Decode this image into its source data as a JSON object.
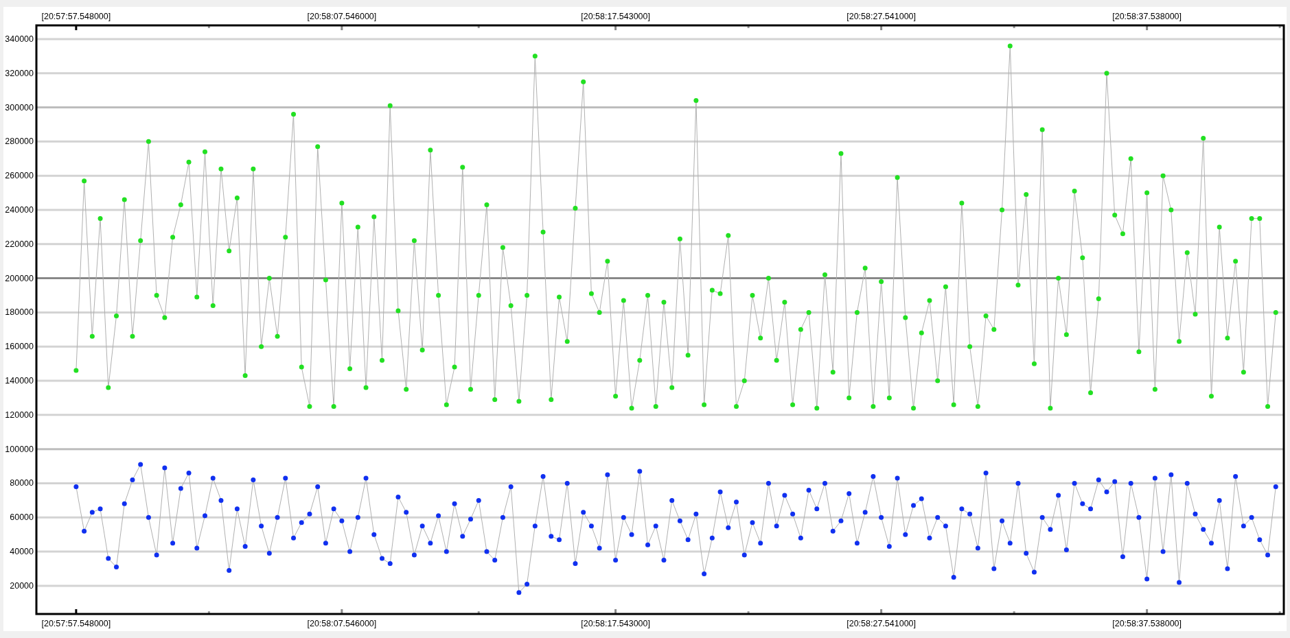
{
  "chart": {
    "chart_data": {
      "type": "line",
      "categories": [
        "[20:57:57.548000]",
        null,
        null,
        null,
        null,
        null,
        null,
        null,
        null,
        null,
        null,
        null,
        null,
        null,
        null,
        null,
        null,
        null,
        null,
        null,
        null,
        null,
        null,
        null,
        null,
        null,
        null,
        null,
        null,
        null,
        null,
        null,
        null,
        "[20:58:07.546000]",
        null,
        null,
        null,
        null,
        null,
        null,
        null,
        null,
        null,
        null,
        null,
        null,
        null,
        null,
        null,
        null,
        null,
        null,
        null,
        null,
        null,
        null,
        null,
        null,
        null,
        null,
        null,
        null,
        null,
        null,
        null,
        null,
        null,
        "[20:58:17.543000]",
        null,
        null,
        null,
        null,
        null,
        null,
        null,
        null,
        null,
        null,
        null,
        null,
        null,
        null,
        null,
        null,
        null,
        null,
        null,
        null,
        null,
        null,
        null,
        null,
        null,
        null,
        null,
        null,
        null,
        null,
        null,
        null,
        "[20:58:27.541000]",
        null,
        null,
        null,
        null,
        null,
        null,
        null,
        null,
        null,
        null,
        null,
        null,
        null,
        null,
        null,
        null,
        null,
        null,
        null,
        null,
        null,
        null,
        null,
        null,
        null,
        null,
        null,
        null,
        null,
        null,
        null,
        null,
        "[20:58:37.538000]",
        null,
        null,
        null,
        null,
        null,
        null,
        null,
        null,
        null,
        null,
        null,
        null,
        null,
        null,
        null,
        null
      ],
      "series": [
        {
          "color": "#22e022",
          "marker": "circle",
          "values": [
            146000,
            257000,
            166000,
            235000,
            136000,
            178000,
            246000,
            166000,
            222000,
            280000,
            190000,
            177000,
            224000,
            243000,
            268000,
            189000,
            274000,
            184000,
            264000,
            216000,
            247000,
            143000,
            264000,
            160000,
            200000,
            166000,
            224000,
            296000,
            148000,
            125000,
            277000,
            199000,
            125000,
            244000,
            147000,
            230000,
            136000,
            236000,
            152000,
            301000,
            181000,
            135000,
            222000,
            158000,
            275000,
            190000,
            126000,
            148000,
            265000,
            135000,
            190000,
            243000,
            129000,
            218000,
            184000,
            128000,
            190000,
            330000,
            227000,
            129000,
            189000,
            163000,
            241000,
            315000,
            191000,
            180000,
            210000,
            131000,
            187000,
            124000,
            152000,
            190000,
            125000,
            186000,
            136000,
            223000,
            155000,
            304000,
            126000,
            193000,
            191000,
            225000,
            125000,
            140000,
            190000,
            165000,
            200000,
            152000,
            186000,
            126000,
            170000,
            180000,
            124000,
            202000,
            145000,
            273000,
            130000,
            180000,
            206000,
            125000,
            198000,
            130000,
            259000,
            177000,
            124000,
            168000,
            187000,
            140000,
            195000,
            126000,
            244000,
            160000,
            125000,
            178000,
            170000,
            240000,
            336000,
            196000,
            249000,
            150000,
            287000,
            124000,
            200000,
            167000,
            251000,
            212000,
            133000,
            188000,
            320000,
            237000,
            226000,
            270000,
            157000,
            250000,
            135000,
            260000,
            240000,
            163000,
            215000,
            179000,
            282000,
            131000,
            230000,
            165000,
            210000,
            145000,
            235000,
            235000,
            125000,
            180000
          ]
        },
        {
          "color": "#1030f0",
          "marker": "circle",
          "values": [
            78000,
            52000,
            63000,
            65000,
            36000,
            31000,
            68000,
            82000,
            91000,
            60000,
            38000,
            89000,
            45000,
            77000,
            86000,
            42000,
            61000,
            83000,
            70000,
            29000,
            65000,
            43000,
            82000,
            55000,
            39000,
            60000,
            83000,
            48000,
            57000,
            62000,
            78000,
            45000,
            65000,
            58000,
            40000,
            60000,
            83000,
            50000,
            36000,
            33000,
            72000,
            63000,
            38000,
            55000,
            45000,
            61000,
            40000,
            68000,
            49000,
            59000,
            70000,
            40000,
            35000,
            60000,
            78000,
            16000,
            21000,
            55000,
            84000,
            49000,
            47000,
            80000,
            33000,
            63000,
            55000,
            42000,
            85000,
            35000,
            60000,
            50000,
            87000,
            44000,
            55000,
            35000,
            70000,
            58000,
            47000,
            62000,
            27000,
            48000,
            75000,
            54000,
            69000,
            38000,
            57000,
            45000,
            80000,
            55000,
            73000,
            62000,
            48000,
            76000,
            65000,
            80000,
            52000,
            58000,
            74000,
            45000,
            63000,
            84000,
            60000,
            43000,
            83000,
            50000,
            67000,
            71000,
            48000,
            60000,
            55000,
            25000,
            65000,
            62000,
            42000,
            86000,
            30000,
            58000,
            45000,
            80000,
            39000,
            28000,
            60000,
            53000,
            73000,
            41000,
            80000,
            68000,
            65000,
            82000,
            75000,
            81000,
            37000,
            80000,
            60000,
            24000,
            83000,
            40000,
            85000,
            22000,
            80000,
            62000,
            53000,
            45000,
            70000,
            30000,
            84000,
            55000,
            60000,
            47000,
            38000,
            78000
          ]
        }
      ],
      "ylim": [
        3500,
        348000
      ],
      "grid": true,
      "yticks": [
        20000,
        40000,
        60000,
        80000,
        100000,
        120000,
        140000,
        160000,
        180000,
        200000,
        220000,
        240000,
        260000,
        280000,
        300000,
        320000,
        340000
      ],
      "ref_lines": [
        {
          "axis": "y",
          "value": 200000
        }
      ]
    }
  }
}
